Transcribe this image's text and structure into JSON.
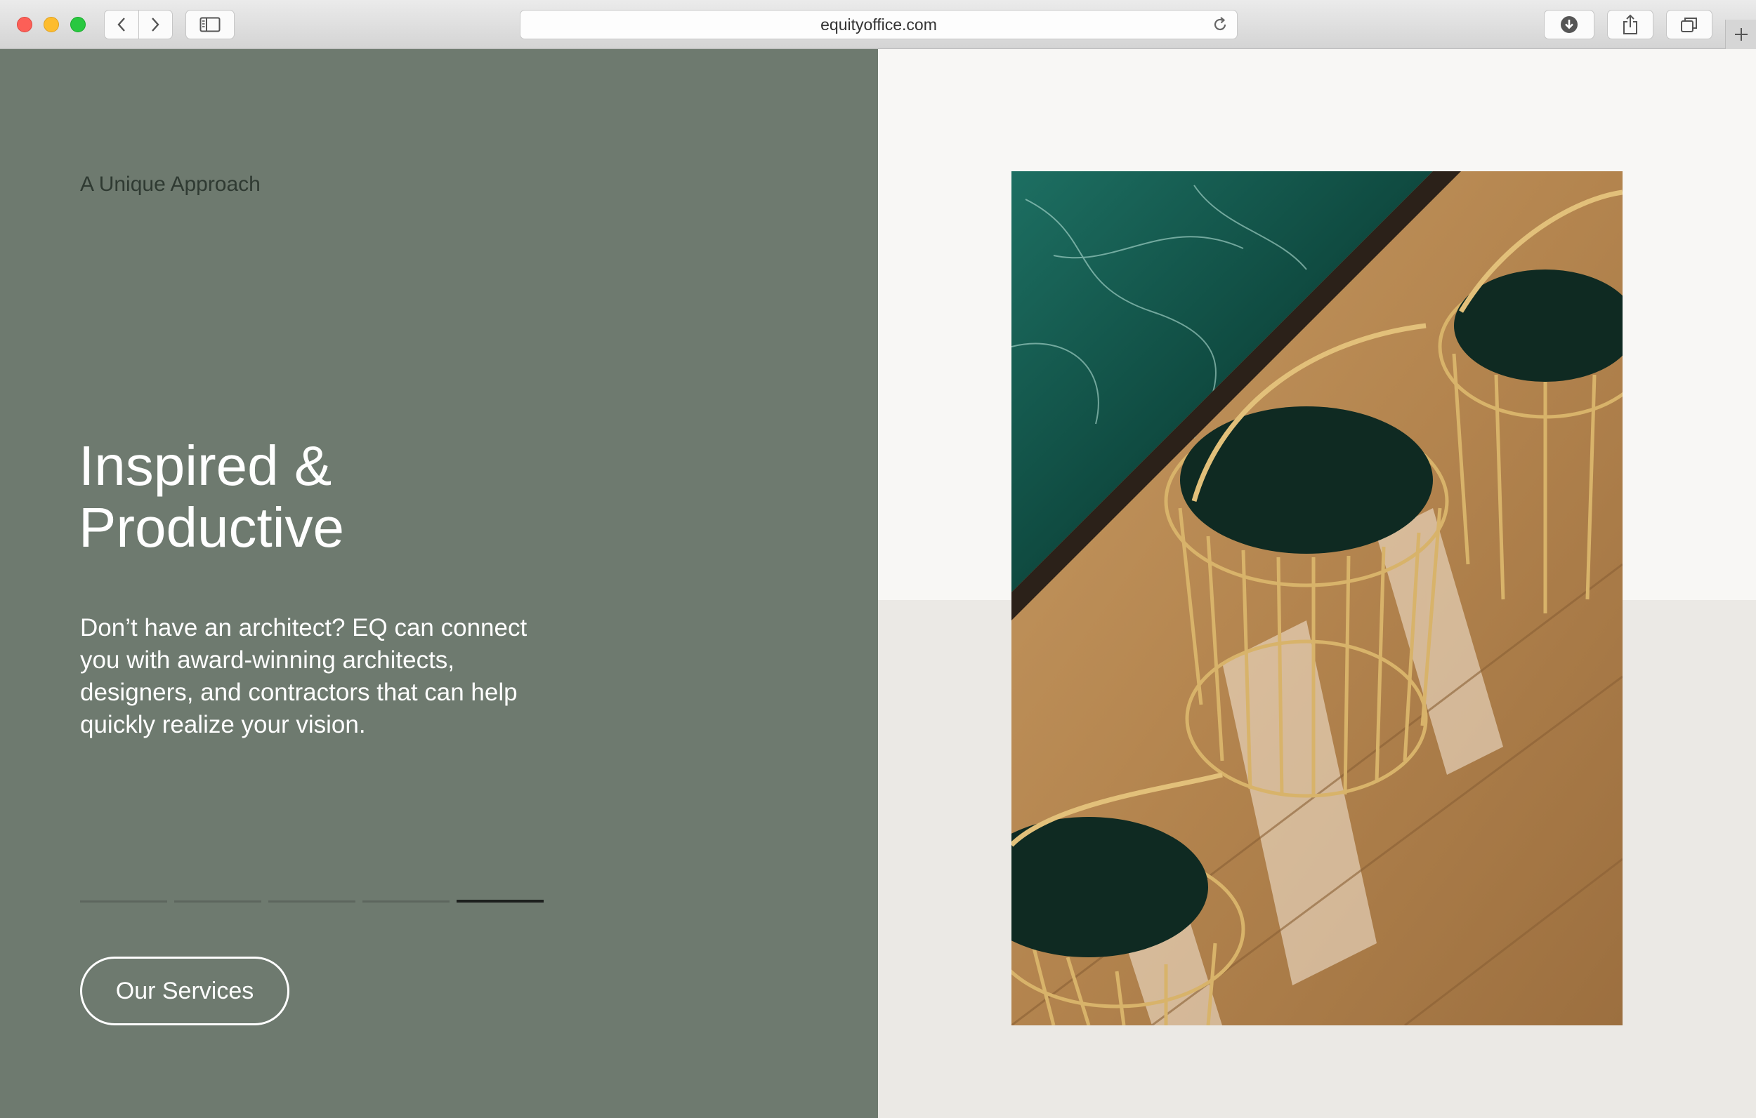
{
  "browser": {
    "url": "equityoffice.com",
    "icons": {
      "back": "chevron-left-icon",
      "forward": "chevron-right-icon",
      "sidebar": "sidebar-icon",
      "reload": "reload-icon",
      "download": "download-icon",
      "share": "share-icon",
      "tabs": "tabs-icon",
      "new_tab": "plus-icon"
    }
  },
  "hero": {
    "eyebrow": "A Unique Approach",
    "headline_line1": "Inspired &",
    "headline_line2": "Productive",
    "body": "Don’t have an architect? EQ can connect you with award-winning architects, designers, and contractors that can help quickly realize your vision.",
    "cta_label": "Our Services",
    "slides_total": 5,
    "active_slide": 5
  },
  "colors": {
    "left_panel": "#6e7a6f",
    "right_top": "#f8f7f5",
    "right_bottom": "#ebe9e5",
    "marble": "#0f4a40",
    "brass": "#c9a25a",
    "wood": "#b98e57"
  }
}
